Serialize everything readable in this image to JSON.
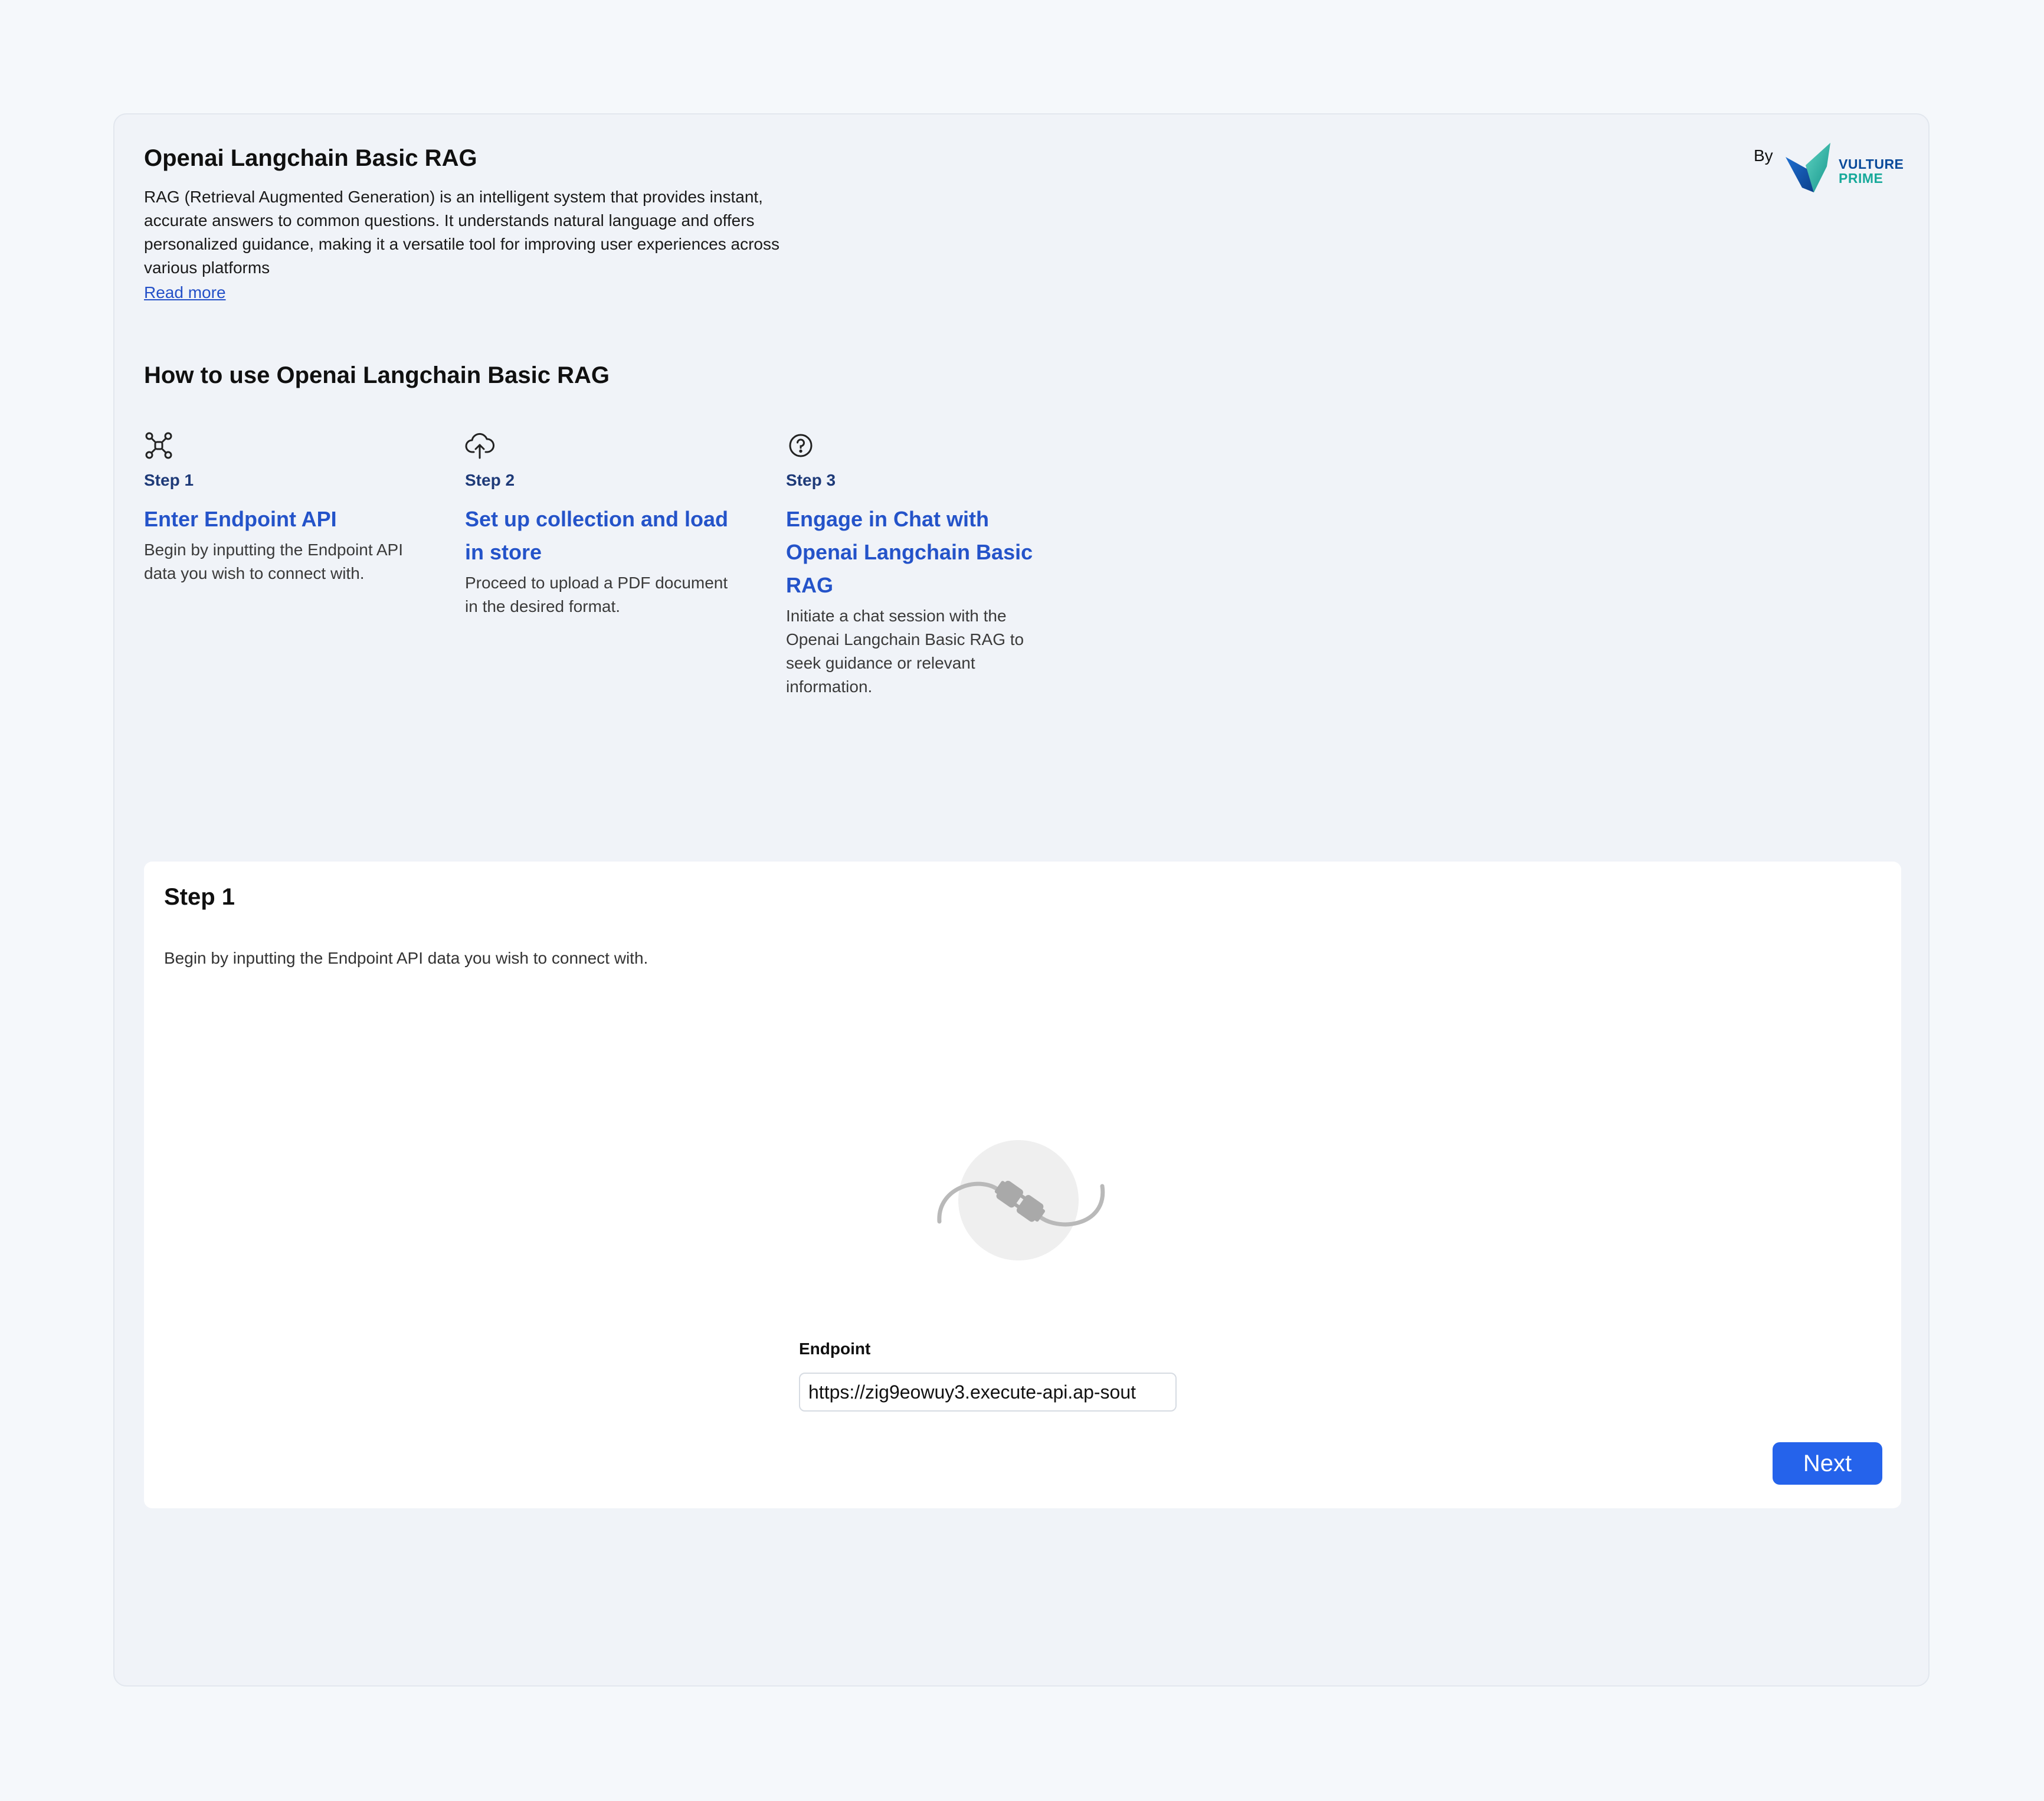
{
  "header": {
    "title": "Openai Langchain Basic RAG",
    "description": "RAG (Retrieval Augmented Generation) is an intelligent system that provides instant, accurate answers to common questions. It understands natural language and offers personalized guidance, making it a versatile tool for improving user experiences across various platforms",
    "read_more": "Read more",
    "by_label": "By",
    "brand": {
      "line1": "VULTURE",
      "line2": "PRIME",
      "colors": {
        "dark": "#0a4a9a",
        "teal": "#17a99a"
      }
    }
  },
  "howto": {
    "title": "How to use Openai Langchain Basic RAG",
    "steps": [
      {
        "icon": "network-icon",
        "number": "Step 1",
        "title": "Enter Endpoint API",
        "description": "Begin by inputting the Endpoint API data you wish to connect with."
      },
      {
        "icon": "cloud-upload-icon",
        "number": "Step 2",
        "title": "Set up collection and load in store",
        "description": "Proceed to upload a PDF document in the desired format."
      },
      {
        "icon": "question-circle-icon",
        "number": "Step 3",
        "title": "Engage in Chat with Openai Langchain Basic RAG",
        "description": "Initiate a chat session with the Openai Langchain Basic RAG to seek guidance or relevant information."
      }
    ]
  },
  "current_step": {
    "title": "Step 1",
    "description": "Begin by inputting the Endpoint API data you wish to connect with.",
    "illustration": "plug-icon",
    "endpoint": {
      "label": "Endpoint",
      "value": "https://zig9eowuy3.execute-api.ap-sout"
    },
    "next_label": "Next"
  },
  "colors": {
    "accent": "#2563eb",
    "step_title": "#2453c9",
    "step_number": "#1e3a78"
  }
}
